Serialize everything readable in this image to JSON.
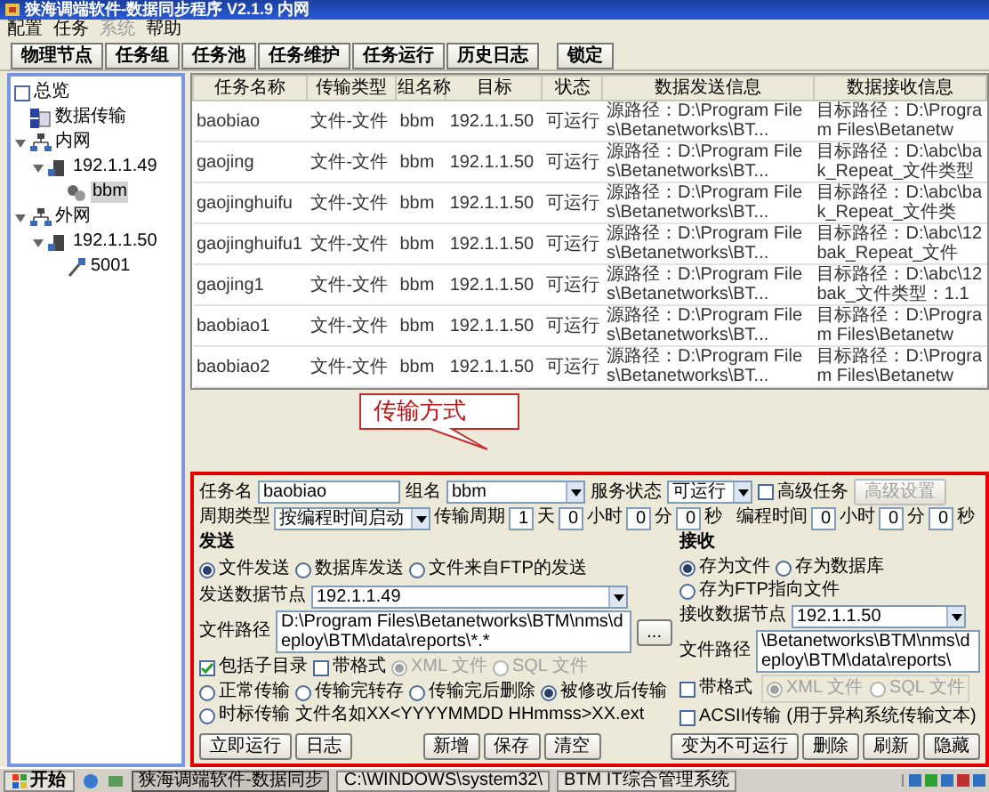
{
  "window": {
    "title": "狭海调端软件-数据同步程序 V2.1.9 内网"
  },
  "menu": [
    {
      "label": "配置",
      "disabled": false
    },
    {
      "label": "任务",
      "disabled": false
    },
    {
      "label": "系统",
      "disabled": true
    },
    {
      "label": "帮助",
      "disabled": false
    }
  ],
  "toolbar": {
    "buttons": [
      "物理节点",
      "任务组",
      "任务池",
      "任务维护",
      "任务运行",
      "历史日志"
    ],
    "lock_button": "锁定"
  },
  "tree": {
    "root": {
      "label": "总览",
      "checked": false
    },
    "items": [
      {
        "label": "数据传输",
        "kind": "transfer",
        "selected": false
      },
      {
        "label": "内网",
        "kind": "network",
        "selected": false,
        "expanded": true,
        "children": [
          {
            "label": "192.1.1.49",
            "kind": "host",
            "selected": false,
            "expanded": true,
            "children": [
              {
                "label": "bbm",
                "kind": "group",
                "selected": true
              }
            ]
          }
        ]
      },
      {
        "label": "外网",
        "kind": "network",
        "selected": false,
        "expanded": true,
        "children": [
          {
            "label": "192.1.1.50",
            "kind": "host",
            "selected": false,
            "expanded": true,
            "children": [
              {
                "label": "5001",
                "kind": "port",
                "selected": false
              }
            ]
          }
        ]
      }
    ]
  },
  "table": {
    "columns": [
      "任务名称",
      "传输类型",
      "组名称",
      "目标",
      "状态",
      "数据发送信息",
      "数据接收信息"
    ],
    "rows": [
      [
        "baobiao",
        "文件-文件",
        "bbm",
        "192.1.1.50",
        "可运行",
        "源路径：D:\\Program Files\\Betanetworks\\BT...",
        "目标路径：D:\\Program Files\\Betanetw"
      ],
      [
        "gaojing",
        "文件-文件",
        "bbm",
        "192.1.1.50",
        "可运行",
        "源路径：D:\\Program Files\\Betanetworks\\BT...",
        "目标路径：D:\\abc\\bak_Repeat_文件类型"
      ],
      [
        "gaojinghuifu",
        "文件-文件",
        "bbm",
        "192.1.1.50",
        "可运行",
        "源路径：D:\\Program Files\\Betanetworks\\BT...",
        "目标路径：D:\\abc\\bak_Repeat_文件类"
      ],
      [
        "gaojinghuifu1",
        "文件-文件",
        "bbm",
        "192.1.1.50",
        "可运行",
        "源路径：D:\\Program Files\\Betanetworks\\BT...",
        "目标路径：D:\\abc\\12bak_Repeat_文件"
      ],
      [
        "gaojing1",
        "文件-文件",
        "bbm",
        "192.1.1.50",
        "可运行",
        "源路径：D:\\Program Files\\Betanetworks\\BT...",
        "目标路径：D:\\abc\\12bak_文件类型：1.1"
      ],
      [
        "baobiao1",
        "文件-文件",
        "bbm",
        "192.1.1.50",
        "可运行",
        "源路径：D:\\Program Files\\Betanetworks\\BT...",
        "目标路径：D:\\Program Files\\Betanetw"
      ],
      [
        "baobiao2",
        "文件-文件",
        "bbm",
        "192.1.1.50",
        "可运行",
        "源路径：D:\\Program Files\\Betanetworks\\BT...",
        "目标路径：D:\\Program Files\\Betanetw"
      ]
    ]
  },
  "callout": {
    "text": "传输方式"
  },
  "form": {
    "task_name": {
      "label": "任务名",
      "value": "baobiao"
    },
    "group": {
      "label": "组名",
      "value": "bbm"
    },
    "service_state": {
      "label": "服务状态",
      "value": "可运行"
    },
    "advanced_task": {
      "label": "高级任务",
      "checked": false
    },
    "advanced_settings": {
      "label": "高级设置",
      "disabled": true
    },
    "cycle_type": {
      "label": "周期类型",
      "value": "按编程时间启动"
    },
    "transfer_period": {
      "label": "传输周期",
      "parts": [
        {
          "value": "1",
          "unit": "天"
        },
        {
          "value": "0",
          "unit": "小时"
        },
        {
          "value": "0",
          "unit": "分"
        },
        {
          "value": "0",
          "unit": "秒"
        }
      ]
    },
    "programmed_time": {
      "label": "编程时间",
      "parts": [
        {
          "value": "0",
          "unit": "小时"
        },
        {
          "value": "0",
          "unit": "分"
        },
        {
          "value": "0",
          "unit": "秒"
        }
      ]
    },
    "send": {
      "title": "发送",
      "modes": [
        {
          "label": "文件发送",
          "selected": true
        },
        {
          "label": "数据库发送",
          "selected": false
        },
        {
          "label": "文件来自FTP的发送",
          "selected": false
        }
      ],
      "node": {
        "label": "发送数据节点",
        "value": "192.1.1.49"
      },
      "path": {
        "label": "文件路径",
        "value": "D:\\Program Files\\Betanetworks\\BTM\\nms\\deploy\\BTM\\data\\reports\\*.*",
        "browse": "..."
      },
      "include_subdirs": {
        "label": "包括子目录",
        "checked": true
      },
      "formatted": {
        "label": "带格式",
        "checked": false
      },
      "formats": [
        {
          "label": "XML 文件",
          "selected": true,
          "disabled": true
        },
        {
          "label": "SQL 文件",
          "selected": false,
          "disabled": true
        }
      ],
      "transfer_modes": [
        {
          "label": "正常传输",
          "selected": false
        },
        {
          "label": "传输完转存",
          "selected": false
        },
        {
          "label": "传输完后删除",
          "selected": false
        },
        {
          "label": "被修改后传输",
          "selected": true
        },
        {
          "label": "时标传输",
          "selected": false
        }
      ],
      "timestamp_hint": "文件名如XX<YYYYMMDD HHmmss>XX.ext"
    },
    "receive": {
      "title": "接收",
      "modes": [
        {
          "label": "存为文件",
          "selected": true
        },
        {
          "label": "存为数据库",
          "selected": false
        },
        {
          "label": "存为FTP指向文件",
          "selected": false
        }
      ],
      "node": {
        "label": "接收数据节点",
        "value": "192.1.1.50"
      },
      "path": {
        "label": "文件路径",
        "value": "\\Betanetworks\\BTM\\nms\\deploy\\BTM\\data\\reports\\"
      },
      "formatted": {
        "label": "带格式",
        "checked": false
      },
      "formats": [
        {
          "label": "XML 文件",
          "selected": true,
          "disabled": true
        },
        {
          "label": "SQL 文件",
          "selected": false,
          "disabled": true
        }
      ],
      "ascii": {
        "label": "ACSII传输",
        "checked": false
      },
      "ascii_note": "(用于异构系统传输文本)"
    },
    "button_groups": [
      [
        "立即运行",
        "日志"
      ],
      [
        "新增",
        "保存",
        "清空"
      ],
      [
        "变为不可运行",
        "删除",
        "刷新",
        "隐藏"
      ]
    ]
  },
  "taskbar": {
    "start": "开始",
    "tasks": [
      {
        "label": "狭海调端软件-数据同步",
        "selected": true
      },
      {
        "label": "C:\\WINDOWS\\system32\\",
        "selected": false
      },
      {
        "label": "BTM IT综合管理系统",
        "selected": false
      }
    ]
  }
}
